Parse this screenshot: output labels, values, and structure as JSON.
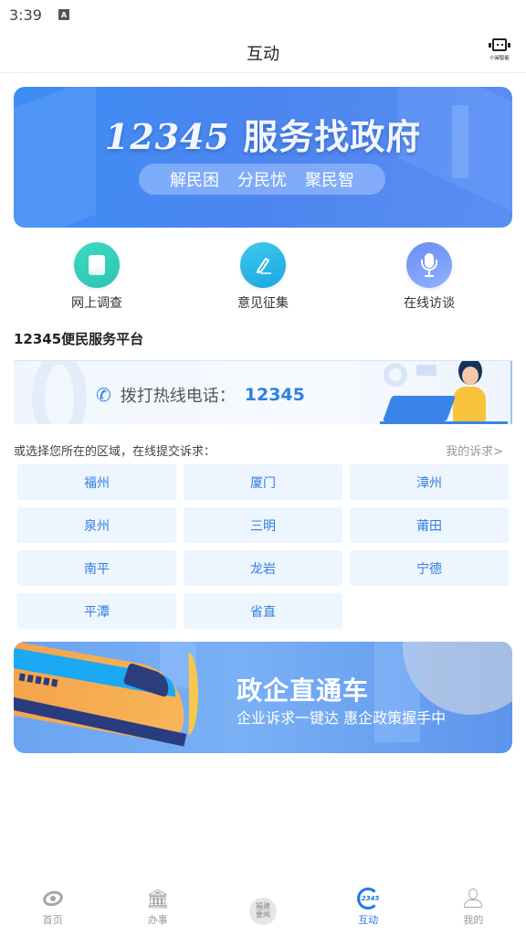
{
  "status_bar": {
    "time": "3:39",
    "indicator": "A"
  },
  "header": {
    "title": "互动",
    "assistant_label": "小闽智能"
  },
  "banner": {
    "title_number": "12345",
    "title_text": "服务找政府",
    "slogans": [
      "解民困",
      "分民忧",
      "聚民智"
    ]
  },
  "quick_actions": [
    {
      "label": "网上调查",
      "icon": "survey-icon"
    },
    {
      "label": "意见征集",
      "icon": "pen-icon"
    },
    {
      "label": "在线访谈",
      "icon": "microphone-icon"
    }
  ],
  "platform": {
    "title": "12345便民服务平台",
    "hotline_label": "拨打热线电话：",
    "hotline_number": "12345"
  },
  "regions": {
    "prompt": "或选择您所在的区域，在线提交诉求：",
    "my_appeals": "我的诉求>",
    "items": [
      "福州",
      "厦门",
      "漳州",
      "泉州",
      "三明",
      "莆田",
      "南平",
      "龙岩",
      "宁德",
      "平潭",
      "省直"
    ]
  },
  "enterprise_banner": {
    "title": "政企直通车",
    "subtitle": "企业诉求一键达 惠企政策握手中"
  },
  "tabbar": {
    "items": [
      {
        "label": "首页",
        "icon": "home-eye-icon",
        "active": false
      },
      {
        "label": "办事",
        "icon": "government-building-icon",
        "active": false
      },
      {
        "label": "",
        "icon": "fujian-news-icon",
        "icon_text": "福建要闻",
        "active": false
      },
      {
        "label": "互动",
        "icon": "hotline-12345-icon",
        "icon_text": "12345",
        "active": true
      },
      {
        "label": "我的",
        "icon": "user-icon",
        "active": false
      }
    ]
  },
  "colors": {
    "accent": "#2277e8",
    "region_bg": "#edf5fe",
    "region_text": "#2f7ee0"
  }
}
